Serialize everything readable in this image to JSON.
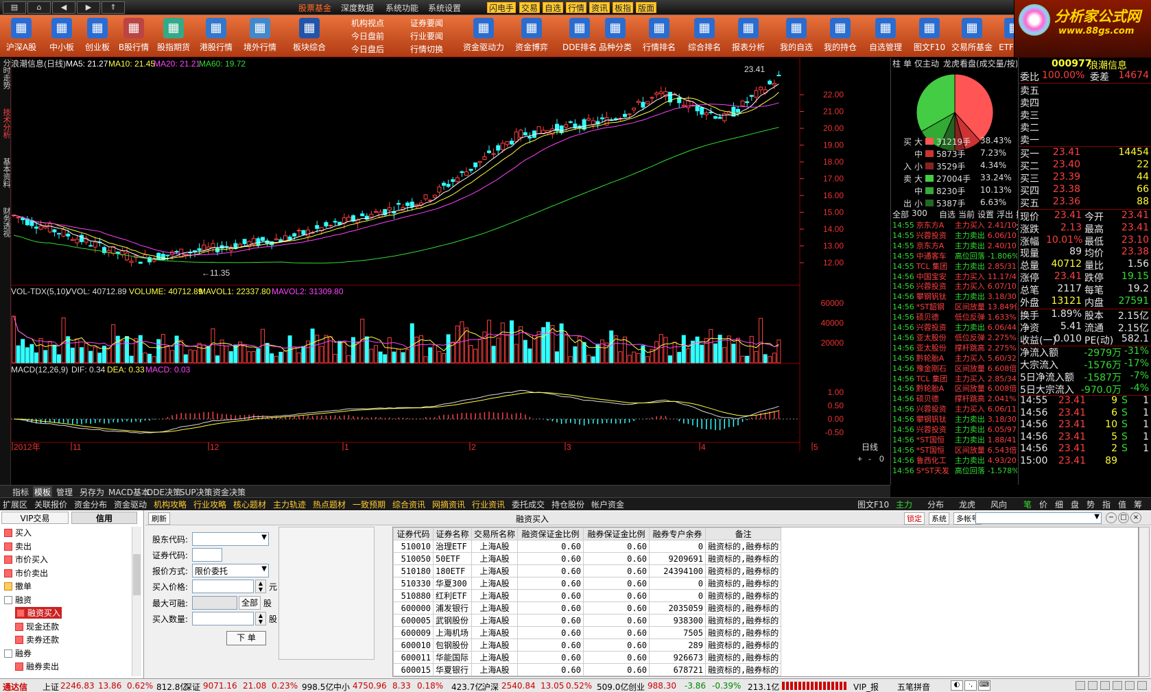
{
  "menubar": {
    "items": [
      "股票基金",
      "深度数据",
      "系统功能",
      "系统设置"
    ],
    "quick": [
      "闪电手",
      "交易",
      "自选",
      "行情",
      "资讯",
      "板指",
      "版面"
    ]
  },
  "toolbar": {
    "items": [
      "沪深A股",
      "中小板",
      "创业板",
      "B股行情",
      "股指期货",
      "港股行情",
      "境外行情",
      "板块综合"
    ],
    "sub1": [
      "机构视点",
      "今日盘前",
      "今日盘后"
    ],
    "sub2": [
      "证券要闻",
      "行业要闻",
      "行情切换"
    ],
    "items2": [
      "资金驱动力",
      "资金博弈",
      "DDE排名",
      "品种分类",
      "行情排名",
      "综合排名",
      "报表分析",
      "我的自选",
      "我的持仓",
      "自选管理",
      "图文F10",
      "交易所基金",
      "ETF基金",
      "基金日历",
      "基金动态"
    ]
  },
  "logo": {
    "text": "分析家公式网",
    "url": "www.88gs.com"
  },
  "lefttabs": [
    "分时走势",
    "技术分析",
    "基本资料",
    "财务透视"
  ],
  "chart": {
    "title": "浪潮信息(日线)",
    "ma5": "MA5: 21.27",
    "ma10": "MA10: 21.45",
    "ma20": "MA20: 21.21",
    "ma60": "MA60: 19.72",
    "hi_label": "23.41",
    "lo_label": "←11.35",
    "price_ticks": [
      "22.00",
      "21.00",
      "20.00",
      "19.00",
      "18.00",
      "17.00",
      "16.00",
      "15.00",
      "14.00",
      "13.00",
      "12.00"
    ],
    "vol_legend": "VOL-TDX(5,10)",
    "vvol": "VVOL: 40712.89",
    "volume": "VOLUME: 40712.89",
    "mavol1": "MAVOL1: 22337.80",
    "mavol2": "MAVOL2: 31309.80",
    "vol_ticks": [
      "60000",
      "40000",
      "20000"
    ],
    "macd_legend": "MACD(12,26,9)",
    "dif": "DIF: 0.34",
    "dea": "DEA: 0.33",
    "macd": "MACD: 0.03",
    "macd_ticks": [
      "1.00",
      "0.50",
      "0.00",
      "-0.50"
    ],
    "date_labels": [
      "2012年",
      "11",
      "12",
      "1",
      "2",
      "3",
      "4",
      "5"
    ],
    "period": "日线",
    "zoom": [
      "+",
      "-",
      "0"
    ]
  },
  "tabs1": [
    "指标",
    "模板",
    "管理",
    "另存为",
    "MACD基本",
    "DDE决策",
    "SUP决策",
    "资金决策"
  ],
  "tabs2": [
    "扩展区",
    "关联报价",
    "资金分布",
    "资金驱动",
    "机构攻略",
    "行业攻略",
    "核心题材",
    "主力轨迹",
    "热点题材",
    "一致预期",
    "综合资讯",
    "网摘资讯",
    "行业资讯",
    "委托成交",
    "持仓股份",
    "帐户资金"
  ],
  "tabs2r": "图文F10",
  "tabs3": [
    "主力",
    "分布",
    "龙虎",
    "风向"
  ],
  "tabs4": [
    "笔",
    "价",
    "细",
    "盘",
    "势",
    "指",
    "值",
    "筹"
  ],
  "rp1": {
    "tabs": [
      "柱",
      "单",
      "仅主动",
      "龙虎看盘(成交量/按)"
    ],
    "flows": [
      [
        "买",
        "大",
        "31219手",
        "38.43%"
      ],
      [
        "",
        "中",
        "5873手",
        "7.23%"
      ],
      [
        "入",
        "小",
        "3529手",
        "4.34%"
      ],
      [
        "卖",
        "大",
        "27004手",
        "33.24%"
      ],
      [
        "",
        "中",
        "8230手",
        "10.13%"
      ],
      [
        "出",
        "小",
        "5387手",
        "6.63%"
      ]
    ],
    "filter": [
      "全部",
      "300",
      "自选",
      "当前",
      "设置",
      "浮出",
      "扩大"
    ],
    "tape": [
      [
        "14:55",
        "京东方A",
        "主力买入",
        "2.41/10"
      ],
      [
        "14:55",
        "兴蓉投资",
        "主力卖出",
        "6.06/10"
      ],
      [
        "14:55",
        "京东方A",
        "主力卖出",
        "2.40/10"
      ],
      [
        "14:55",
        "中通客车",
        "高位回落",
        "-1.806%"
      ],
      [
        "14:55",
        "TCL 集团",
        "主力卖出",
        "2.85/31"
      ],
      [
        "14:56",
        "中国宝安",
        "主力买入",
        "11.17/4"
      ],
      [
        "14:56",
        "兴蓉投资",
        "主力买入",
        "6.07/10"
      ],
      [
        "14:56",
        "攀钢钒钛",
        "主力卖出",
        "3.18/30"
      ],
      [
        "14:56",
        "*ST韶钢",
        "区间放量",
        "13.849倍"
      ],
      [
        "14:56",
        "硕贝德",
        "低位反弹",
        "1.633%"
      ],
      [
        "14:56",
        "兴蓉投资",
        "主力卖出",
        "6.06/44"
      ],
      [
        "14:56",
        "亚太股份",
        "低位反弹",
        "2.275%"
      ],
      [
        "14:56",
        "亚太股份",
        "撑杆跳高",
        "2.275%"
      ],
      [
        "14:56",
        "黔轮胎A",
        "主力买入",
        "5.60/32"
      ],
      [
        "14:56",
        "豫金刚石",
        "区间放量",
        "6.608倍"
      ],
      [
        "14:56",
        "TCL 集团",
        "主力买入",
        "2.85/34"
      ],
      [
        "14:56",
        "黔轮胎A",
        "区间放量",
        "6.008倍"
      ],
      [
        "14:56",
        "硕贝德",
        "撑杆跳高",
        "2.041%"
      ],
      [
        "14:56",
        "兴蓉投资",
        "主力买入",
        "6.06/11"
      ],
      [
        "14:56",
        "攀钢钒钛",
        "主力卖出",
        "3.18/30"
      ],
      [
        "14:56",
        "兴蓉投资",
        "主力卖出",
        "6.05/97"
      ],
      [
        "14:56",
        "*ST国恒",
        "主力卖出",
        "1.88/41"
      ],
      [
        "14:56",
        "*ST国恒",
        "区间放量",
        "6.543倍"
      ],
      [
        "14:56",
        "鲁西化工",
        "主力卖出",
        "4.93/20"
      ],
      [
        "14:56",
        "S*ST天发",
        "高位回落",
        "-1.578%"
      ]
    ],
    "pie": {
      "buy_big": 38.43,
      "buy_mid": 7.23,
      "buy_small": 4.34,
      "sell_big": 33.24,
      "sell_mid": 10.13,
      "sell_small": 6.63
    }
  },
  "rp2": {
    "code": "000977",
    "name": "浪潮信息",
    "weibi": "委比",
    "weibi_v": "100.00%",
    "weicha": "委差",
    "weicha_v": "14674",
    "sells": [
      [
        "卖五",
        "",
        ""
      ],
      [
        "卖四",
        "",
        ""
      ],
      [
        "卖三",
        "",
        ""
      ],
      [
        "卖二",
        "",
        ""
      ],
      [
        "卖一",
        "",
        ""
      ]
    ],
    "buys": [
      [
        "买一",
        "23.41",
        "14454"
      ],
      [
        "买二",
        "23.40",
        "22"
      ],
      [
        "买三",
        "23.39",
        "44"
      ],
      [
        "买四",
        "23.38",
        "66"
      ],
      [
        "买五",
        "23.36",
        "88"
      ]
    ],
    "stats": [
      [
        "现价",
        "23.41",
        "今开",
        "23.41"
      ],
      [
        "涨跌",
        "2.13",
        "最高",
        "23.41"
      ],
      [
        "涨幅",
        "10.01%",
        "最低",
        "23.10"
      ],
      [
        "现量",
        "89",
        "均价",
        "23.38"
      ],
      [
        "总量",
        "40712",
        "量比",
        "1.56"
      ],
      [
        "涨停",
        "23.41",
        "跌停",
        "19.15"
      ],
      [
        "总笔",
        "2117",
        "每笔",
        "19.2"
      ],
      [
        "外盘",
        "13121",
        "内盘",
        "27591"
      ]
    ],
    "stats2": [
      [
        "换手",
        "1.89%",
        "股本",
        "2.15亿"
      ],
      [
        "净资",
        "5.41",
        "流通",
        "2.15亿"
      ],
      [
        "收益(一)",
        "0.010",
        "PE(动)",
        "582.1"
      ]
    ],
    "flows": [
      [
        "净流入额",
        "-2979万",
        "-31%"
      ],
      [
        "大宗流入",
        "-1576万",
        "-17%"
      ],
      [
        "5日净流入额",
        "-1587万",
        "-7%"
      ],
      [
        "5日大宗流入",
        "-970.0万",
        "-4%"
      ]
    ],
    "ticks": [
      [
        "14:55",
        "23.41",
        "9",
        "S",
        "1"
      ],
      [
        "14:56",
        "23.41",
        "6",
        "S",
        "1"
      ],
      [
        "14:56",
        "23.41",
        "10",
        "S",
        "1"
      ],
      [
        "14:56",
        "23.41",
        "5",
        "S",
        "1"
      ],
      [
        "14:56",
        "23.41",
        "2",
        "S",
        "1"
      ],
      [
        "15:00",
        "23.41",
        "89",
        "",
        ""
      ]
    ]
  },
  "order": {
    "tabs": [
      "VIP交易",
      "信用"
    ],
    "tree": [
      "买入",
      "卖出",
      "市价买入",
      "市价卖出",
      "撤单",
      "融资",
      "融资买入",
      "现金还款",
      "卖券还款",
      "融券",
      "融券卖出"
    ],
    "refresh": "刷新",
    "title": "融资买入",
    "toprt": [
      "锁定",
      "系统",
      "多帐号"
    ],
    "form": {
      "holder": "股东代码:",
      "code": "证券代码:",
      "pricetype": "报价方式:",
      "pricetype_v": "限价委托",
      "price": "买入价格:",
      "unit": "元",
      "max": "最大可融:",
      "all": "全部",
      "gu": "股",
      "qty": "买入数量:",
      "gu2": "股",
      "submit": "下 单"
    },
    "cols": [
      "证券代码",
      "证券名称",
      "交易所名称",
      "融资保证金比例",
      "融券保证金比例",
      "融券专户余券",
      "备注"
    ],
    "rows": [
      [
        "510010",
        "治理ETF",
        "上海A股",
        "0.60",
        "0.60",
        "0",
        "融资标的,融券标的"
      ],
      [
        "510050",
        "50ETF",
        "上海A股",
        "0.60",
        "0.60",
        "9209691",
        "融资标的,融券标的"
      ],
      [
        "510180",
        "180ETF",
        "上海A股",
        "0.60",
        "0.60",
        "24394100",
        "融资标的,融券标的"
      ],
      [
        "510330",
        "华夏300",
        "上海A股",
        "0.60",
        "0.60",
        "0",
        "融资标的,融券标的"
      ],
      [
        "510880",
        "红利ETF",
        "上海A股",
        "0.60",
        "0.60",
        "0",
        "融资标的,融券标的"
      ],
      [
        "600000",
        "浦发银行",
        "上海A股",
        "0.60",
        "0.60",
        "2035059",
        "融资标的,融券标的"
      ],
      [
        "600005",
        "武钢股份",
        "上海A股",
        "0.60",
        "0.60",
        "938300",
        "融资标的,融券标的"
      ],
      [
        "600009",
        "上海机场",
        "上海A股",
        "0.60",
        "0.60",
        "7505",
        "融资标的,融券标的"
      ],
      [
        "600010",
        "包钢股份",
        "上海A股",
        "0.60",
        "0.60",
        "289",
        "融资标的,融券标的"
      ],
      [
        "600011",
        "华能国际",
        "上海A股",
        "0.60",
        "0.60",
        "926673",
        "融资标的,融券标的"
      ],
      [
        "600015",
        "华夏银行",
        "上海A股",
        "0.60",
        "0.60",
        "678721",
        "融资标的,融券标的"
      ]
    ]
  },
  "status": {
    "brand": "通达信",
    "sh": "上证",
    "sh_v": "2246.83",
    "sh_c": "13.86",
    "sh_p": "0.62%",
    "sh_a": "812.8亿",
    "sz": "深证",
    "sz_v": "9071.16",
    "sz_c": "21.08",
    "sz_p": "0.23%",
    "sz_a": "998.5亿",
    "zx": "中小",
    "zx_v": "4750.96",
    "zx_c": "8.33",
    "zx_p": "0.18%",
    "zx_a": "423.7亿",
    "hs": "沪深",
    "hs_v": "2540.84",
    "hs_c": "13.05",
    "hs_p": "0.52%",
    "hs_a": "509.0亿",
    "cy": "创业",
    "cy_v": "988.30",
    "cy_c": "-3.86",
    "cy_p": "-0.39%",
    "cy_a": "213.1亿",
    "vip": "VIP_报",
    "ime": "五笔拼音"
  },
  "colors": {
    "up": "#ff4040",
    "down": "#33ffff",
    "ma5": "#ffffff",
    "ma10": "#ffff44",
    "ma20": "#ff44ff",
    "ma60": "#33dd33"
  }
}
